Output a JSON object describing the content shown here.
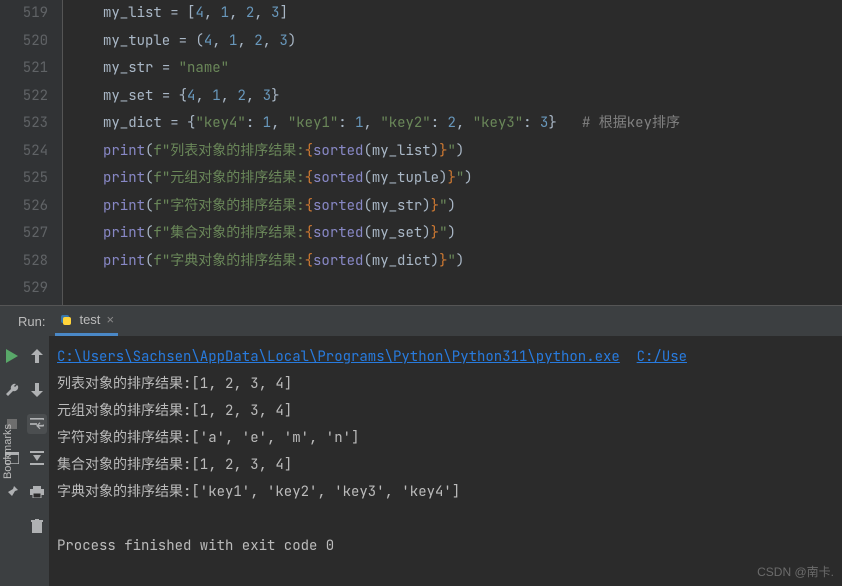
{
  "gutter": {
    "start": 519,
    "end": 529
  },
  "code": [
    {
      "n": 519,
      "kind": "assign",
      "lhs": "my_list",
      "open": "[",
      "vals": [
        "4",
        "1",
        "2",
        "3"
      ],
      "close": "]"
    },
    {
      "n": 520,
      "kind": "assign",
      "lhs": "my_tuple",
      "open": "(",
      "vals": [
        "4",
        "1",
        "2",
        "3"
      ],
      "close": ")"
    },
    {
      "n": 521,
      "kind": "assign_str",
      "lhs": "my_str",
      "str": "\"name\""
    },
    {
      "n": 522,
      "kind": "assign",
      "lhs": "my_set",
      "open": "{",
      "vals": [
        "4",
        "1",
        "2",
        "3"
      ],
      "close": "}"
    },
    {
      "n": 523,
      "kind": "dict",
      "lhs": "my_dict",
      "pairs": [
        [
          "\"key4\"",
          "1"
        ],
        [
          "\"key1\"",
          "1"
        ],
        [
          "\"key2\"",
          "2"
        ],
        [
          "\"key3\"",
          "3"
        ]
      ],
      "comment": "# 根据key排序"
    },
    {
      "n": 524,
      "kind": "print",
      "label": "列表对象的排序结果:",
      "arg": "my_list"
    },
    {
      "n": 525,
      "kind": "print",
      "label": "元组对象的排序结果:",
      "arg": "my_tuple"
    },
    {
      "n": 526,
      "kind": "print",
      "label": "字符对象的排序结果:",
      "arg": "my_str"
    },
    {
      "n": 527,
      "kind": "print",
      "label": "集合对象的排序结果:",
      "arg": "my_set"
    },
    {
      "n": 528,
      "kind": "print",
      "label": "字典对象的排序结果:",
      "arg": "my_dict"
    },
    {
      "n": 529,
      "kind": "blank"
    }
  ],
  "run": {
    "label": "Run:",
    "tab_name": "test",
    "exe_path": "C:\\Users\\Sachsen\\AppData\\Local\\Programs\\Python\\Python311\\python.exe",
    "script_path_partial": "C:/Use",
    "output": [
      "列表对象的排序结果:[1, 2, 3, 4]",
      "元组对象的排序结果:[1, 2, 3, 4]",
      "字符对象的排序结果:['a', 'e', 'm', 'n']",
      "集合对象的排序结果:[1, 2, 3, 4]",
      "字典对象的排序结果:['key1', 'key2', 'key3', 'key4']"
    ],
    "exit": "Process finished with exit code 0"
  },
  "sidebar_label": "Bookmarks",
  "watermark": "CSDN @南卡."
}
